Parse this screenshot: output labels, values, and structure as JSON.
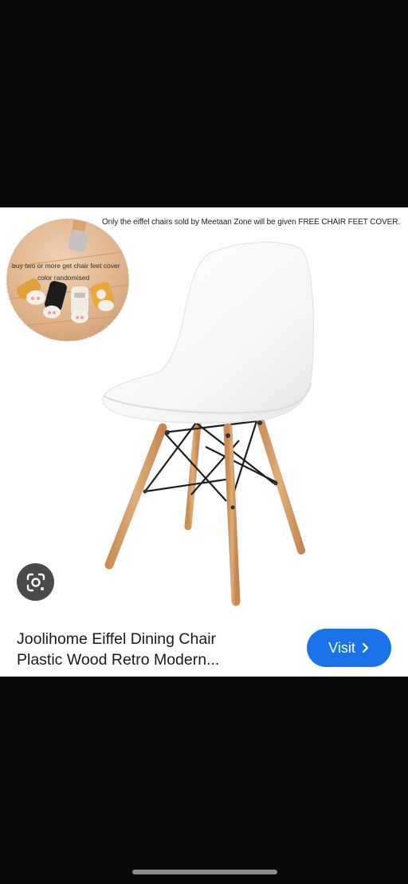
{
  "promo": {
    "banner_text": "Only the eiffel chairs sold by Meetaan Zone will be given FREE CHAIR FEET COVER.",
    "inset_line1": "buy two or more get chair feet cover",
    "inset_line2": "color randomised"
  },
  "product": {
    "title_line1": "Joolihome Eiffel Dining Chair",
    "title_line2": "Plastic Wood Retro Modern..."
  },
  "actions": {
    "visit_label": "Visit",
    "visit_icon": "chevron-right-icon",
    "lens_icon": "google-lens-icon"
  },
  "colors": {
    "background": "#0a0a0a",
    "card": "#ffffff",
    "visit_button": "#1a73e8",
    "lens_button": "#4a4a4a"
  }
}
